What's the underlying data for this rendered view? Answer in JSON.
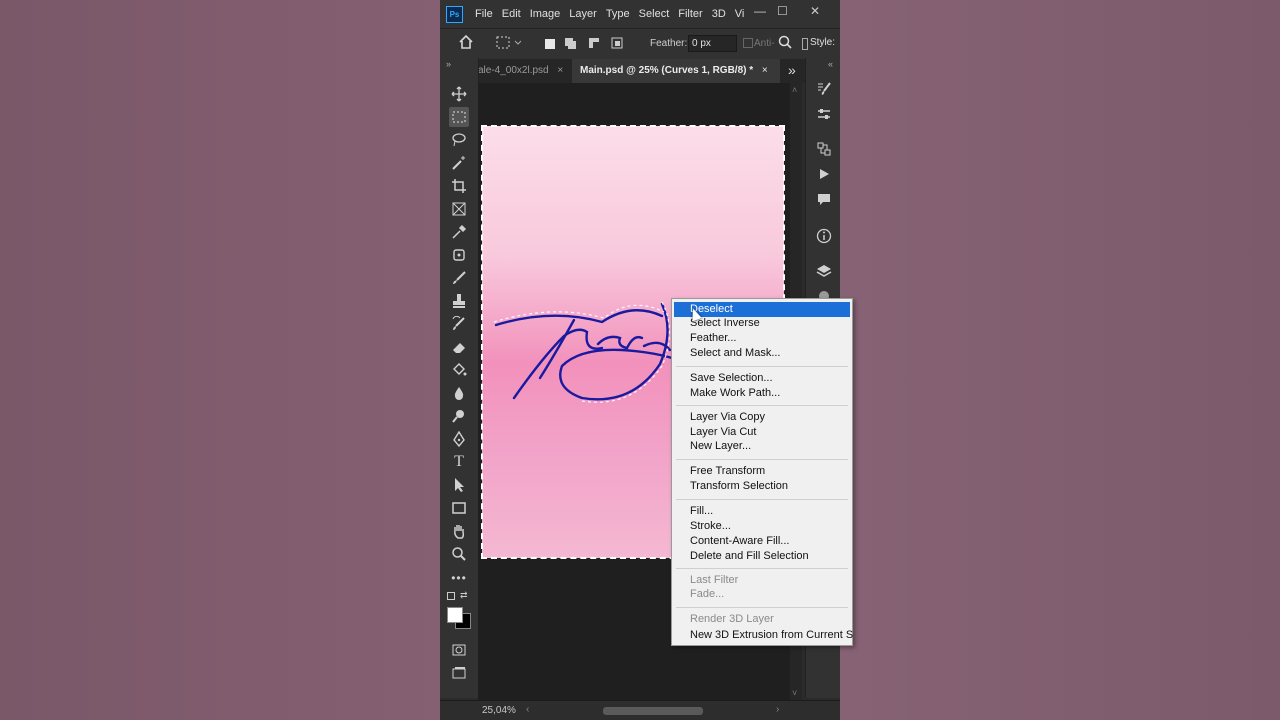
{
  "app": {
    "logo": "Ps",
    "menu": [
      "File",
      "Edit",
      "Image",
      "Layer",
      "Type",
      "Select",
      "Filter",
      "3D",
      "Vi"
    ],
    "window_controls": {
      "minimize": "—",
      "maximize": "☐",
      "close": "✕"
    }
  },
  "options_bar": {
    "feather_label": "Feather:",
    "feather_value": "0 px",
    "antialias_label": "Anti-",
    "style_label": "Style:"
  },
  "tabs": [
    {
      "label": "ale-4_00x2l.psd",
      "close": "×",
      "active": false
    },
    {
      "label": "Main.psd @ 25% (Curves 1, RGB/8) *",
      "close": "×",
      "active": true
    }
  ],
  "tabs_more": "»",
  "status": {
    "zoom": "25,04%",
    "left_arrow": "‹",
    "right_arrow": "›"
  },
  "context_menu": {
    "items": [
      {
        "label": "Deselect",
        "state": "selected"
      },
      {
        "label": "Select Inverse",
        "state": "normal"
      },
      {
        "label": "Feather...",
        "state": "normal"
      },
      {
        "label": "Select and Mask...",
        "state": "normal"
      },
      {
        "label": "Save Selection...",
        "state": "normal"
      },
      {
        "label": "Make Work Path...",
        "state": "normal"
      },
      {
        "label": "Layer Via Copy",
        "state": "normal"
      },
      {
        "label": "Layer Via Cut",
        "state": "normal"
      },
      {
        "label": "New Layer...",
        "state": "normal"
      },
      {
        "label": "Free Transform",
        "state": "normal"
      },
      {
        "label": "Transform Selection",
        "state": "normal"
      },
      {
        "label": "Fill...",
        "state": "normal"
      },
      {
        "label": "Stroke...",
        "state": "normal"
      },
      {
        "label": "Content-Aware Fill...",
        "state": "normal"
      },
      {
        "label": "Delete and Fill Selection",
        "state": "normal"
      },
      {
        "label": "Last Filter",
        "state": "disabled"
      },
      {
        "label": "Fade...",
        "state": "disabled"
      },
      {
        "label": "Render 3D Layer",
        "state": "disabled"
      },
      {
        "label": "New 3D Extrusion from Current S",
        "state": "normal"
      }
    ]
  },
  "colors": {
    "accent_highlight": "#1c6fd6",
    "ps_blue": "#31a8ff",
    "app_panel": "#323232",
    "canvas_bg": "#1f1f1f",
    "signature_ink": "#1a1a9a"
  },
  "icons": {
    "toolbar": [
      "move-icon",
      "marquee-icon",
      "lasso-icon",
      "magic-wand-icon",
      "crop-icon",
      "frame-icon",
      "eyedropper-icon",
      "spot-heal-icon",
      "brush-icon",
      "stamp-icon",
      "history-brush-icon",
      "eraser-icon",
      "bucket-icon",
      "blur-icon",
      "dodge-icon",
      "pen-icon",
      "type-icon",
      "path-select-icon",
      "rectangle-icon",
      "hand-icon",
      "zoom-icon",
      "more-icon"
    ],
    "panel": [
      "brush-settings-icon",
      "adjustments-icon",
      "channels-icon",
      "play-icon",
      "comment-icon",
      "info-icon",
      "layers-icon"
    ]
  }
}
